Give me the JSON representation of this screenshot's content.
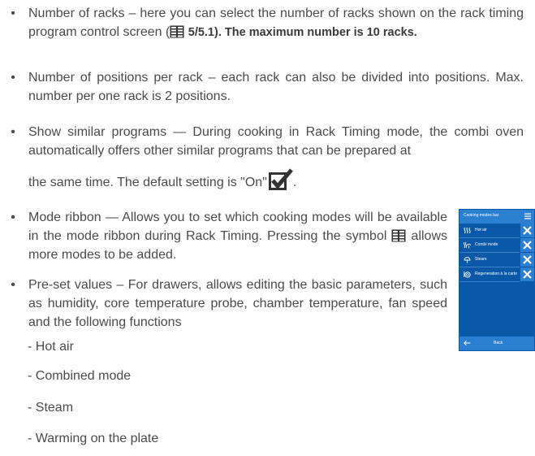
{
  "bullets": [
    {
      "text_a": "Number of racks – here you can select the number of racks shown on the rack timing program control screen (",
      "ref": "5/5.1). The maximum number is 10 racks."
    },
    {
      "text": "Number of positions per rack – each rack can also be divided into positions. Max. number per one rack is 2 positions."
    },
    {
      "text_a": "Show similar programs — During cooking in Rack Timing mode, the combi oven automatically offers other similar programs that can be prepared at",
      "text_b": "the same time. The default setting is \"On\"",
      "text_c": "."
    },
    {
      "text_a": "Mode ribbon — Allows you to set which cooking modes will be available in the mode ribbon during Rack Timing. Pressing the symbol",
      "text_b": "allows more modes to be added."
    },
    {
      "text": "Pre-set values – For drawers, allows editing the basic parameters, such as humidity, core temperature probe, chamber temperature, fan speed and the following functions"
    }
  ],
  "sub_items": [
    "- Hot air",
    "- Combined mode",
    "- Steam",
    "- Warming on the plate"
  ],
  "device": {
    "title": "Cooking modes bar",
    "rows": [
      {
        "label": "Hot air",
        "icon": "hot-air-icon"
      },
      {
        "label": "Combi mode",
        "icon": "combi-mode-icon"
      },
      {
        "label": "Steam",
        "icon": "steam-icon"
      },
      {
        "label": "Regeneration à la carte",
        "icon": "regeneration-icon"
      }
    ],
    "back_label": "Back"
  },
  "bullet_char": "•",
  "colors": {
    "text": "#4a4a4a",
    "device_bg": "#0a58a8",
    "device_accent": "#2b7fd1"
  }
}
